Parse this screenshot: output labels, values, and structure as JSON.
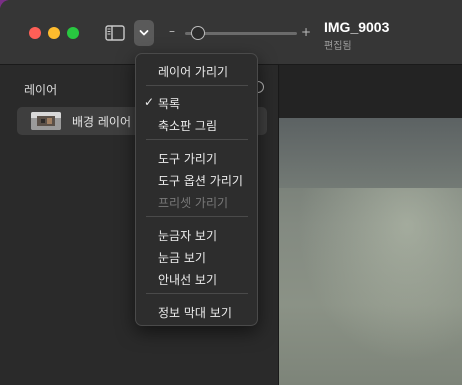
{
  "document": {
    "title": "IMG_9003",
    "subtitle": "편집됨"
  },
  "toolbar": {
    "zoom_minus": "–",
    "zoom_plus": "+",
    "zoom_fraction": 0.12
  },
  "sidebar": {
    "title": "레이어",
    "layers": [
      {
        "label": "배경 레이어",
        "selected": true
      }
    ]
  },
  "menu": {
    "items": [
      {
        "label": "레이어 가리기"
      },
      {
        "label": "목록",
        "checked": true,
        "check_glyph": "✓"
      },
      {
        "label": "축소판 그림"
      },
      {
        "label": "도구 가리기"
      },
      {
        "label": "도구 옵션 가리기"
      },
      {
        "label": "프리셋 가리기",
        "disabled": true
      },
      {
        "label": "눈금자 보기"
      },
      {
        "label": "눈금 보기"
      },
      {
        "label": "안내선 보기"
      },
      {
        "label": "정보 막대 보기"
      }
    ]
  },
  "colors": {
    "desktop": "#7a2f86",
    "window": "#2b2b2b",
    "close": "#fe5f57",
    "minimize": "#febc2e",
    "zoom": "#28c840"
  }
}
